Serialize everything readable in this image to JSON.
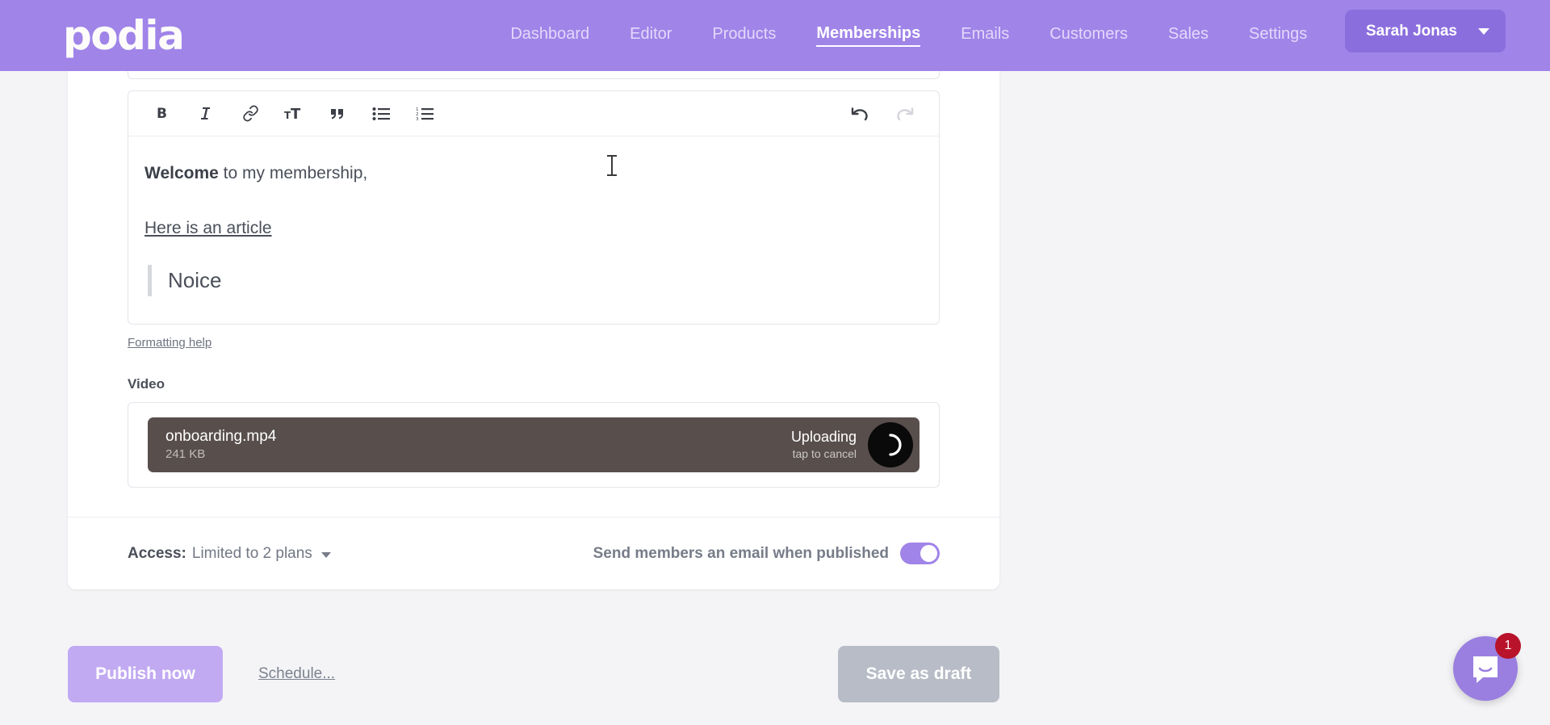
{
  "header": {
    "logo": "podia",
    "nav": [
      {
        "label": "Dashboard",
        "active": false
      },
      {
        "label": "Editor",
        "active": false
      },
      {
        "label": "Products",
        "active": false
      },
      {
        "label": "Memberships",
        "active": true
      },
      {
        "label": "Emails",
        "active": false
      },
      {
        "label": "Customers",
        "active": false
      },
      {
        "label": "Sales",
        "active": false
      },
      {
        "label": "Settings",
        "active": false
      }
    ],
    "user": "Sarah Jonas",
    "brand_color": "#a084e8",
    "user_button_color": "#8b6ede"
  },
  "editor": {
    "toolbar": [
      {
        "name": "bold",
        "label": "B"
      },
      {
        "name": "italic",
        "label": "I"
      },
      {
        "name": "link",
        "label": "Link"
      },
      {
        "name": "heading",
        "label": "TT"
      },
      {
        "name": "quote",
        "label": "Quote"
      },
      {
        "name": "bullet-list",
        "label": "Bulleted list"
      },
      {
        "name": "numbered-list",
        "label": "Numbered list"
      },
      {
        "name": "undo",
        "label": "Undo",
        "enabled": true
      },
      {
        "name": "redo",
        "label": "Redo",
        "enabled": false
      }
    ],
    "content": {
      "paragraph_bold": "Welcome",
      "paragraph_rest": " to my membership,",
      "link_text": "Here is an article",
      "quote_text": "Noice"
    },
    "formatting_help": "Formatting help"
  },
  "video": {
    "section_label": "Video",
    "upload": {
      "filename": "onboarding.mp4",
      "filesize": "241 KB",
      "status": "Uploading",
      "status_sub": "tap to cancel",
      "bar_color": "#584f4d"
    }
  },
  "footer": {
    "access_label": "Access:",
    "access_value": "Limited to 2 plans",
    "email_toggle_label": "Send members an email when published",
    "email_toggle_on": true,
    "toggle_color": "#a084e8"
  },
  "actions": {
    "publish": "Publish now",
    "schedule": "Schedule...",
    "save_draft": "Save as draft",
    "publish_color": "#c2aaf2",
    "draft_color": "#b7bcc6"
  },
  "chat": {
    "badge_count": "1",
    "bubble_color": "#9a7fe0",
    "badge_color": "#b8132a"
  }
}
